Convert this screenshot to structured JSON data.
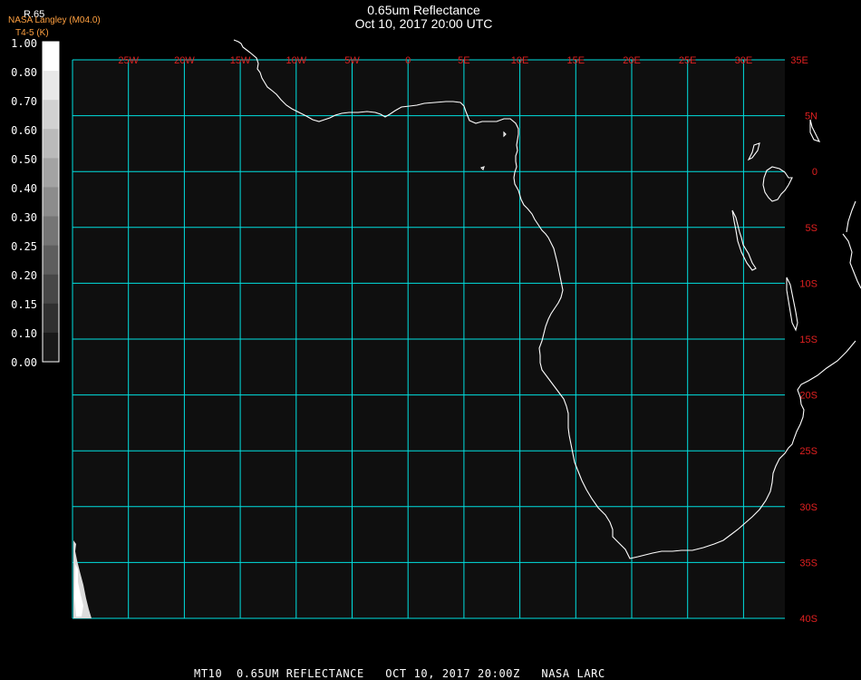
{
  "header": {
    "title": "0.65um Reflectance",
    "subtitle": "Oct 10, 2017 20:00 UTC",
    "channel": "R.65",
    "organization": "NASA Langley (M04.0)",
    "units": "T4-5 (K)"
  },
  "colorbar": {
    "labels": [
      "1.00",
      "0.80",
      "0.70",
      "0.60",
      "0.50",
      "0.40",
      "0.30",
      "0.25",
      "0.20",
      "0.15",
      "0.10",
      "0.00"
    ],
    "values": [
      1.0,
      0.8,
      0.7,
      0.6,
      0.5,
      0.4,
      0.3,
      0.25,
      0.2,
      0.15,
      0.1,
      0.0
    ]
  },
  "map": {
    "lon_labels": [
      "25W",
      "20W",
      "15W",
      "10W",
      "5W",
      "0",
      "5E",
      "10E",
      "15E",
      "20E",
      "25E",
      "30E",
      "35E"
    ],
    "lat_labels": [
      "5N",
      "0",
      "5S",
      "10S",
      "15S",
      "20S",
      "25S",
      "30S",
      "35S",
      "40S"
    ],
    "grid_color": "#00e0e0",
    "coast_color": "#ffffff",
    "label_color": "#e02020",
    "background": "#0f0f0f"
  },
  "footer": "MT10  0.65UM REFLECTANCE   OCT 10, 2017 20:00Z   NASA LARC"
}
